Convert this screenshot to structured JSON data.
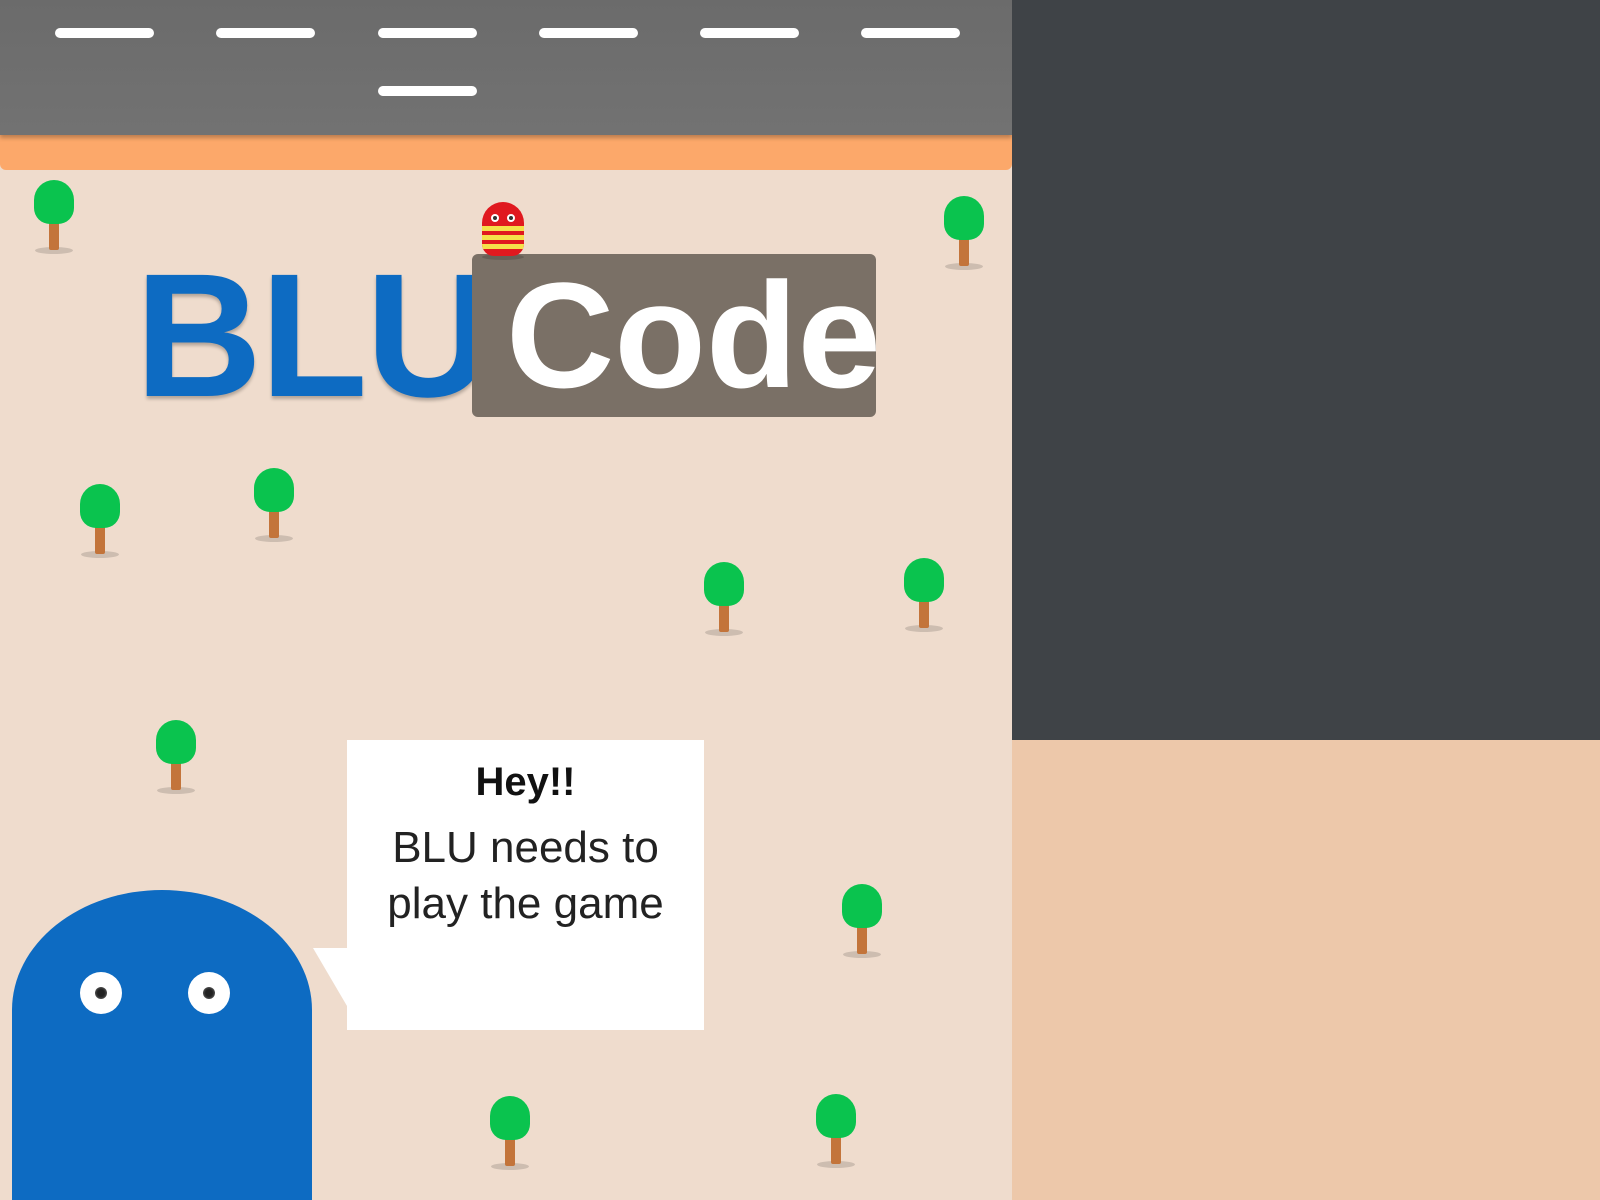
{
  "game": {
    "title": {
      "part1": "BLU",
      "part2": "Code"
    },
    "speech": {
      "heading": "Hey!!",
      "message": "BLU needs to play the game"
    },
    "colors": {
      "road": "#6e6e6e",
      "curb": "#fca86a",
      "ground": "#efdccd",
      "blu": "#0d6bc2",
      "tree_crown": "#0ac34e",
      "tree_trunk": "#c3743a",
      "mini_character": "#e0191f",
      "title_box": "#7a7066",
      "side_panel_top": "#3f4347",
      "side_panel_bottom": "#edc8aa"
    },
    "characters": {
      "main": "blu-character",
      "mini": "red-striped-character"
    }
  }
}
